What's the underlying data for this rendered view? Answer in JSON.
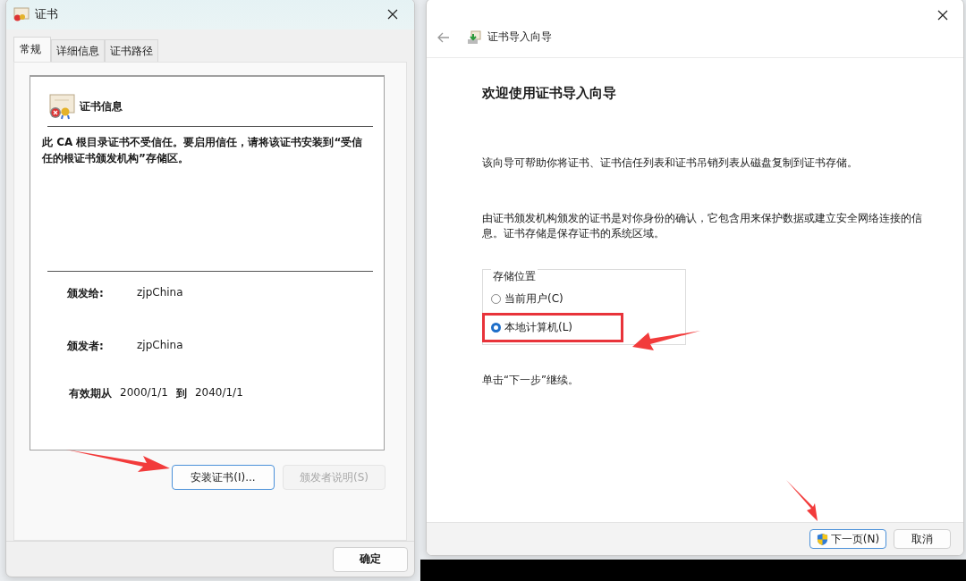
{
  "cert_window": {
    "title": "证书",
    "tabs": [
      {
        "label": "常规",
        "selected": true
      },
      {
        "label": "详细信息",
        "selected": false
      },
      {
        "label": "证书路径",
        "selected": false
      }
    ],
    "info_heading": "证书信息",
    "warning": "此 CA 根目录证书不受信任。要启用信任，请将该证书安装到“受信任的根证书颁发机构”存储区。",
    "fields": [
      {
        "label": "颁发给:",
        "value": "zjpChina"
      },
      {
        "label": "颁发者:",
        "value": "zjpChina"
      }
    ],
    "validity": {
      "label": "有效期从",
      "from": "2000/1/1",
      "to_label": "到",
      "to": "2040/1/1"
    },
    "buttons": [
      {
        "label": "安装证书(I)...",
        "disabled": false,
        "focused": true
      },
      {
        "label": "颁发者说明(S)",
        "disabled": true,
        "focused": false
      }
    ],
    "ok_button": "确定"
  },
  "wizard_window": {
    "title": "证书导入向导",
    "heading": "欢迎使用证书导入向导",
    "paragraphs": [
      "该向导可帮助你将证书、证书信任列表和证书吊销列表从磁盘复制到证书存储。",
      "由证书颁发机构颁发的证书是对你身份的确认，它包含用来保护数据或建立安全网络连接的信息。证书存储是保存证书的系统区域。"
    ],
    "store_group": {
      "label": "存储位置",
      "options": [
        {
          "label": "当前用户(C)",
          "selected": false
        },
        {
          "label": "本地计算机(L)",
          "selected": true
        }
      ]
    },
    "hint": "单击“下一步”继续。",
    "buttons": [
      {
        "label": "下一页(N)",
        "kind": "primary"
      },
      {
        "label": "取消",
        "kind": "normal"
      }
    ]
  }
}
